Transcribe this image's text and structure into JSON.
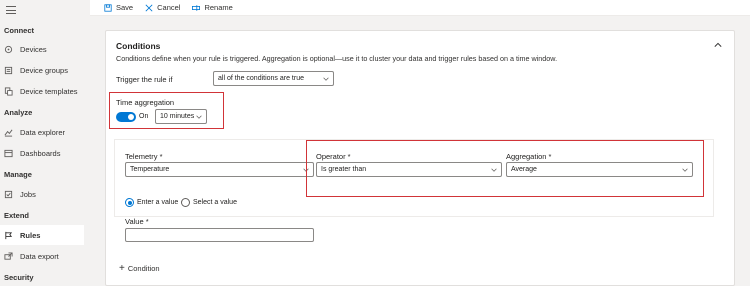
{
  "toolbar": {
    "save": "Save",
    "cancel": "Cancel",
    "rename": "Rename"
  },
  "sidebar": {
    "sections": {
      "connect": "Connect",
      "analyze": "Analyze",
      "manage": "Manage",
      "extend": "Extend",
      "security": "Security"
    },
    "items": [
      {
        "label": "Devices",
        "icon": "devices-icon"
      },
      {
        "label": "Device groups",
        "icon": "device-groups-icon"
      },
      {
        "label": "Device templates",
        "icon": "device-templates-icon"
      },
      {
        "label": "Data explorer",
        "icon": "data-explorer-icon"
      },
      {
        "label": "Dashboards",
        "icon": "dashboards-icon"
      },
      {
        "label": "Jobs",
        "icon": "jobs-icon"
      },
      {
        "label": "Rules",
        "icon": "rules-icon",
        "active": true
      },
      {
        "label": "Data export",
        "icon": "data-export-icon"
      }
    ]
  },
  "conditions": {
    "title": "Conditions",
    "description": "Conditions define when your rule is triggered. Aggregation is optional—use it to cluster your data and trigger rules based on a time window.",
    "trigger_label": "Trigger the rule if",
    "trigger_value": "all of the conditions are true",
    "time_agg_label": "Time aggregation",
    "toggle_state": "On",
    "time_window": "10 minutes",
    "telemetry_label": "Telemetry *",
    "telemetry_value": "Temperature",
    "operator_label": "Operator *",
    "operator_value": "Is greater than",
    "aggregation_label": "Aggregation *",
    "aggregation_value": "Average",
    "radio_enter": "Enter a value",
    "radio_select": "Select a value",
    "value_label": "Value *",
    "value_input": "",
    "add_condition": "Condition"
  },
  "colors": {
    "accent": "#0078d4",
    "highlight": "#d13438"
  }
}
